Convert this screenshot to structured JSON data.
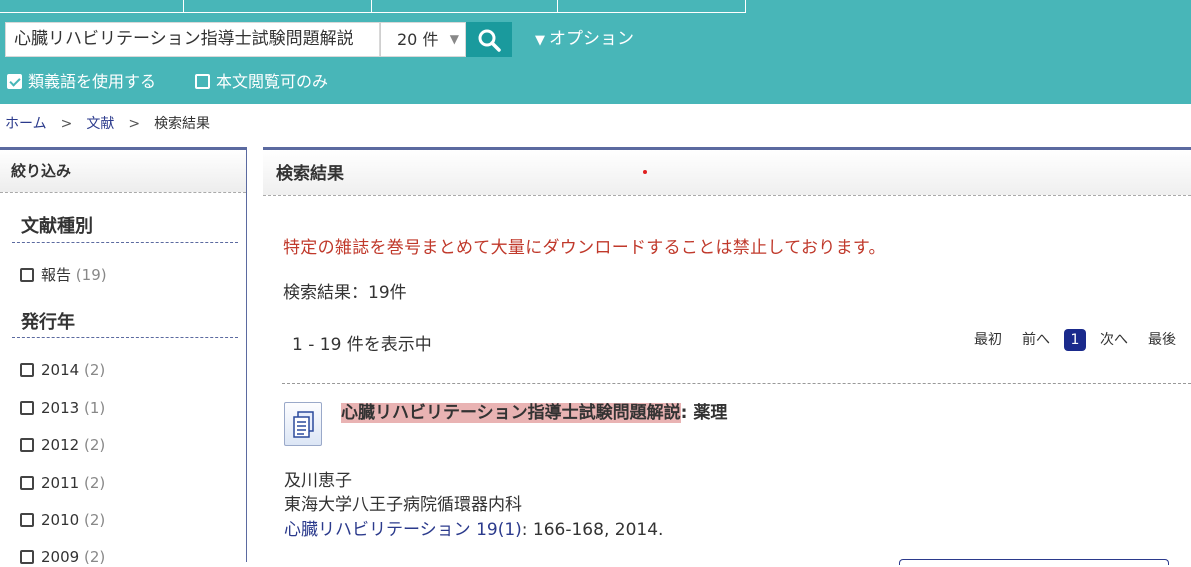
{
  "header": {
    "search_value": "心臓リハビリテーション指導士試験問題解説",
    "count_select": "20 件",
    "options_label": "オプション",
    "synonyms_label": "類義語を使用する",
    "synonyms_checked": true,
    "fulltext_label": "本文閲覧可のみ",
    "fulltext_checked": false,
    "accent_color": "#48b6b8",
    "button_color": "#1a9a9d"
  },
  "breadcrumb": {
    "home": "ホーム",
    "literature": "文献",
    "current": "検索結果",
    "separator": ">"
  },
  "sidebar": {
    "title": "絞り込み",
    "doc_type_heading": "文献種別",
    "doc_types": [
      {
        "label": "報告",
        "count": "(19)"
      }
    ],
    "year_heading": "発行年",
    "years": [
      {
        "label": "2014",
        "count": "(2)"
      },
      {
        "label": "2013",
        "count": "(1)"
      },
      {
        "label": "2012",
        "count": "(2)"
      },
      {
        "label": "2011",
        "count": "(2)"
      },
      {
        "label": "2010",
        "count": "(2)"
      },
      {
        "label": "2009",
        "count": "(2)"
      }
    ]
  },
  "main": {
    "title": "検索結果",
    "warning": "特定の雑誌を巻号まとめて大量にダウンロードすることは禁止しております。",
    "result_count": "検索結果：19件",
    "showing": "1 - 19 件を表示中",
    "pager": {
      "first": "最初",
      "prev": "前へ",
      "current": "1",
      "next": "次へ",
      "last": "最後"
    },
    "results": [
      {
        "title_highlight": "心臓リハビリテーション指導士試験問題解説",
        "title_rest": ": 薬理",
        "author": "及川恵子",
        "affiliation": "東海大学八王子病院循環器内科",
        "journal_link": "心臓リハビリテーション 19(1)",
        "journal_rest": ": 166-168, 2014."
      }
    ]
  }
}
